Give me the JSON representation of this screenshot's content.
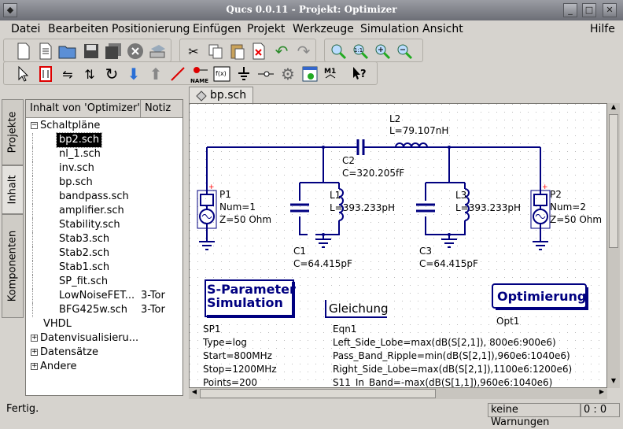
{
  "window": {
    "title": "Qucs 0.0.11 - Projekt: Optimizer"
  },
  "menu": [
    "Datei",
    "Bearbeiten",
    "Positionierung",
    "Einfügen",
    "Projekt",
    "Werkzeuge",
    "Simulation",
    "Ansicht"
  ],
  "menu_help": "Hilfe",
  "side_tabs": {
    "projects": "Projekte",
    "content": "Inhalt",
    "components": "Komponenten"
  },
  "tree": {
    "header_name": "Inhalt von 'Optimizer'",
    "header_note": "Notiz",
    "schematics_label": "Schaltpläne",
    "schematics": [
      {
        "name": "bp2.sch",
        "note": ""
      },
      {
        "name": "nl_1.sch",
        "note": ""
      },
      {
        "name": "inv.sch",
        "note": ""
      },
      {
        "name": "bp.sch",
        "note": ""
      },
      {
        "name": "bandpass.sch",
        "note": ""
      },
      {
        "name": "amplifier.sch",
        "note": ""
      },
      {
        "name": "Stability.sch",
        "note": ""
      },
      {
        "name": "Stab3.sch",
        "note": ""
      },
      {
        "name": "Stab2.sch",
        "note": ""
      },
      {
        "name": "Stab1.sch",
        "note": ""
      },
      {
        "name": "SP_fit.sch",
        "note": ""
      },
      {
        "name": "LowNoiseFET...",
        "note": "3-Tor"
      },
      {
        "name": "BFG425w.sch",
        "note": "3-Tor"
      }
    ],
    "others": [
      "VHDL",
      "Datenvisualisieru...",
      "Datensätze",
      "Andere"
    ]
  },
  "doc_tab": "bp.sch",
  "schematic": {
    "L2": {
      "name": "L2",
      "value": "L=79.107nH"
    },
    "C2": {
      "name": "C2",
      "value": "C=320.205fF"
    },
    "L1": {
      "name": "L1",
      "value": "L=393.233pH"
    },
    "L3": {
      "name": "L3",
      "value": "L=393.233pH"
    },
    "C1": {
      "name": "C1",
      "value": "C=64.415pF"
    },
    "C3": {
      "name": "C3",
      "value": "C=64.415pF"
    },
    "P1": {
      "name": "P1",
      "num": "Num=1",
      "z": "Z=50 Ohm"
    },
    "P2": {
      "name": "P2",
      "num": "Num=2",
      "z": "Z=50 Ohm"
    },
    "sim": {
      "line1": "S-Parameter",
      "line2": "Simulation",
      "name": "SP1",
      "type": "Type=log",
      "start": "Start=800MHz",
      "stop": "Stop=1200MHz",
      "points": "Points=200"
    },
    "eqn": {
      "title": "Gleichung",
      "name": "Eqn1",
      "lines": [
        "Left_Side_Lobe=max(dB(S[2,1]), 800e6:900e6)",
        "Pass_Band_Ripple=min(dB(S[2,1]),960e6:1040e6)",
        "Right_Side_Lobe=max(dB(S[2,1]),1100e6:1200e6)",
        "S11_In_Band=-max(dB(S[1,1]),960e6:1040e6)"
      ]
    },
    "opt": {
      "title": "Optimierung",
      "name": "Opt1"
    }
  },
  "status": {
    "text": "Fertig.",
    "warnings": "keine Warnungen",
    "position": "0 : 0"
  },
  "colors": {
    "wire": "#000080",
    "component": "#000080",
    "port_red": "#ff0000",
    "text": "#000000"
  }
}
